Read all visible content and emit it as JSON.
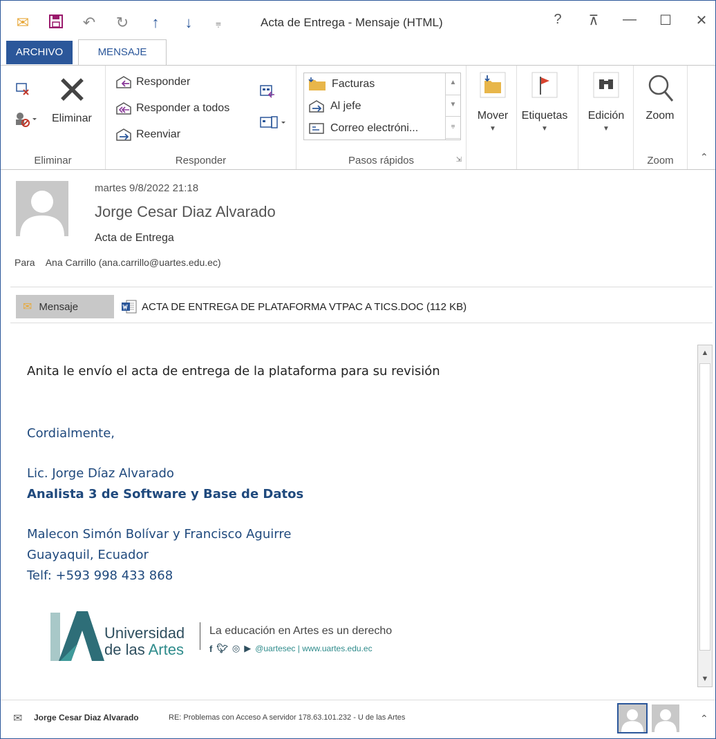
{
  "window": {
    "title": "Acta de Entrega - Mensaje (HTML)",
    "help": "?",
    "controls": {
      "ribbon_display": "⊼",
      "minimize": "—",
      "maximize": "☐",
      "close": "✕"
    }
  },
  "qat": {
    "more": "⩦"
  },
  "tabs": [
    {
      "label": "ARCHIVO",
      "active": false
    },
    {
      "label": "MENSAJE",
      "active": true
    }
  ],
  "ribbon": {
    "eliminar": {
      "delete_label": "Eliminar",
      "group_label": "Eliminar"
    },
    "responder": {
      "reply": "Responder",
      "reply_all": "Responder a todos",
      "forward": "Reenviar",
      "group_label": "Responder"
    },
    "pasos": {
      "items": [
        "Facturas",
        "Al jefe",
        "Correo electróni..."
      ],
      "group_label": "Pasos rápidos"
    },
    "mover": {
      "label": "Mover"
    },
    "etiquetas": {
      "label": "Etiquetas"
    },
    "edicion": {
      "label": "Edición"
    },
    "zoom": {
      "label": "Zoom",
      "group_label": "Zoom"
    }
  },
  "message": {
    "date": "martes 9/8/2022 21:18",
    "sender": "Jorge Cesar Diaz Alvarado",
    "subject": "Acta de Entrega",
    "to_label": "Para",
    "to": "Ana Carrillo (ana.carrillo@uartes.edu.ec)",
    "message_tab": "Mensaje",
    "attachment": "ACTA DE ENTREGA DE PLATAFORMA VTPAC A TICS.DOC (112 KB)"
  },
  "body": {
    "line1": "Anita le envío el acta de entrega de la plataforma para su revisión",
    "greeting": "Cordialmente,",
    "name": "Lic. Jorge Díaz Alvarado",
    "role": "Analista 3 de Software y Base de Datos",
    "address1": "Malecon Simón Bolívar y Francisco Aguirre",
    "address2": "Guayaquil, Ecuador",
    "phone": "Telf: +593 998 433 868"
  },
  "logo": {
    "uni1": "Universidad",
    "uni2a": "de las ",
    "uni2b": "Artes",
    "tagline": "La educación en Artes es un derecho",
    "social": "@uartesec | www.uartes.edu.ec"
  },
  "people_pane": {
    "name": "Jorge Cesar Diaz Alvarado",
    "message": "RE: Problemas con Acceso A servidor 178.63.101.232 - U de las Artes"
  },
  "colors": {
    "accent": "#2b579a",
    "signature": "#1f497d",
    "logo_teal": "#2e8b8b"
  }
}
